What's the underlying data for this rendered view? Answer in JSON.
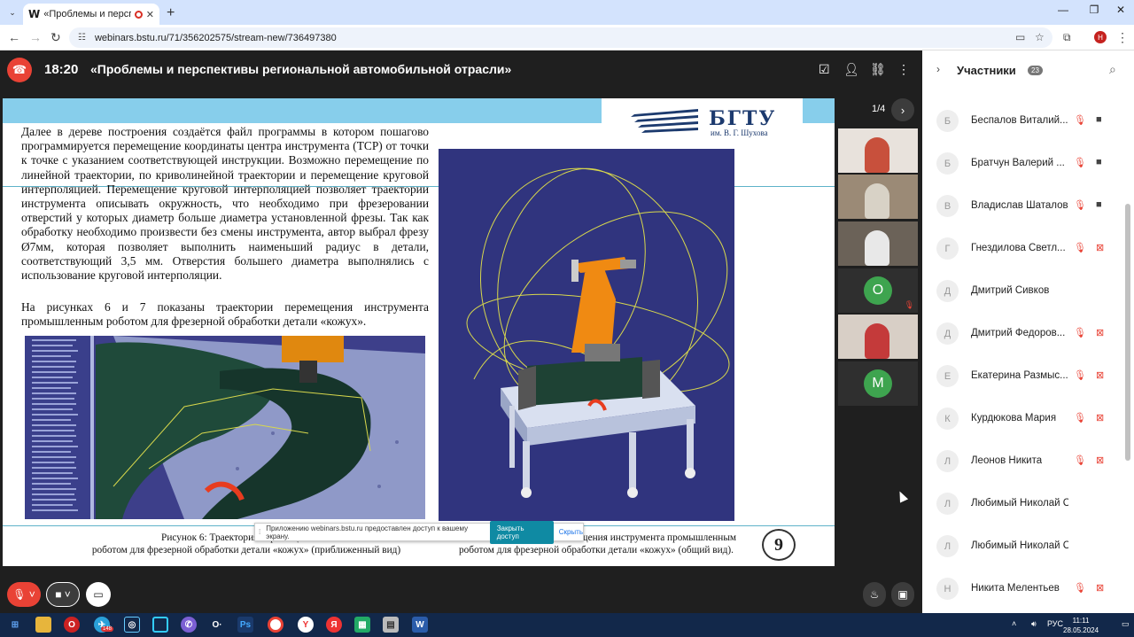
{
  "browser": {
    "tab_title": "«Проблемы и перспективы",
    "tab_letter": "W",
    "url": "webinars.bstu.ru/71/356202575/stream-new/736497380",
    "profile_initial": "Н"
  },
  "meeting": {
    "time": "18:20",
    "title": "«Проблемы и перспективы региональной автомобильной отрасли»"
  },
  "slide": {
    "logo_name": "БГТУ",
    "logo_sub": "им. В. Г. Шухова",
    "paragraph1": "Далее в дереве построения создаётся файл программы в котором пошагово программируется перемещение координаты центра инструмента (TCP) от точки к точке с указанием соответствующей инструкции. Возможно перемещение по линейной траектории, по криволинейной траектории и перемещение круговой интерполяцией. Перемещение круговой интерполяцией позволяет траектории инструмента описывать окружность, что необходимо при фрезеровании отверстий у которых диаметр больше диаметра установленной фрезы. Так как обработку необходимо произвести без смены инструмента, автор выбрал фрезу Ø7мм, которая позволяет выполнить наименьший радиус в детали, соответствующий 3,5 мм. Отверстия большего диаметра выполнялись с использование круговой интерполяции.",
    "paragraph2": "На рисунках 6 и 7 показаны траектории перемещения инструмента промышленным роботом для фрезерной обработки детали «кожух».",
    "caption6_line1": "Рисунок 6: Траектория перемещения ин",
    "caption6_line2": "роботом для фрезерной обработки детали «кожух» (приближенный вид)",
    "caption7_line1": "щения инструмента промышленным",
    "caption7_line2": "роботом для фрезерной обработки детали «кожух» (общий вид).",
    "page_number": "9"
  },
  "share_notice": {
    "message": "Приложению webinars.bstu.ru предоставлен доступ к вашему экрану.",
    "stop_label": "Закрыть доступ",
    "hide_label": "Скрыть"
  },
  "slide_nav": {
    "page": "1/4"
  },
  "tiles": [
    {
      "type": "video"
    },
    {
      "type": "video"
    },
    {
      "type": "video"
    },
    {
      "type": "avatar",
      "initial": "О",
      "color": "#3ea44f"
    },
    {
      "type": "video"
    },
    {
      "type": "avatar",
      "initial": "М",
      "color": "#3ea44f"
    }
  ],
  "participants": {
    "label": "Участники",
    "count": "23",
    "items": [
      {
        "initial": "Б",
        "name": "Беспалов Виталий...",
        "cam": "on"
      },
      {
        "initial": "Б",
        "name": "Братчун Валерий ...",
        "cam": "on"
      },
      {
        "initial": "В",
        "name": "Владислав Шаталов",
        "cam": "on"
      },
      {
        "initial": "Г",
        "name": "Гнездилова Светл...",
        "cam": "off"
      },
      {
        "initial": "Д",
        "name": "Дмитрий Сивков",
        "cam": "none"
      },
      {
        "initial": "Д",
        "name": "Дмитрий Федоров...",
        "cam": "off"
      },
      {
        "initial": "Е",
        "name": "Екатерина Размыс...",
        "cam": "off"
      },
      {
        "initial": "К",
        "name": "Курдюкова Мария",
        "cam": "off"
      },
      {
        "initial": "Л",
        "name": "Леонов Никита",
        "cam": "off"
      },
      {
        "initial": "Л",
        "name": "Любимый Николай Се... я",
        "cam": "none"
      },
      {
        "initial": "Л",
        "name": "Любимый Николай Сергеевич",
        "cam": "none"
      },
      {
        "initial": "Н",
        "name": "Никита Мелентьев",
        "cam": "off"
      }
    ]
  },
  "taskbar": {
    "lang": "РУС",
    "time": "11:11",
    "date": "28.05.2024",
    "badge": "148"
  }
}
